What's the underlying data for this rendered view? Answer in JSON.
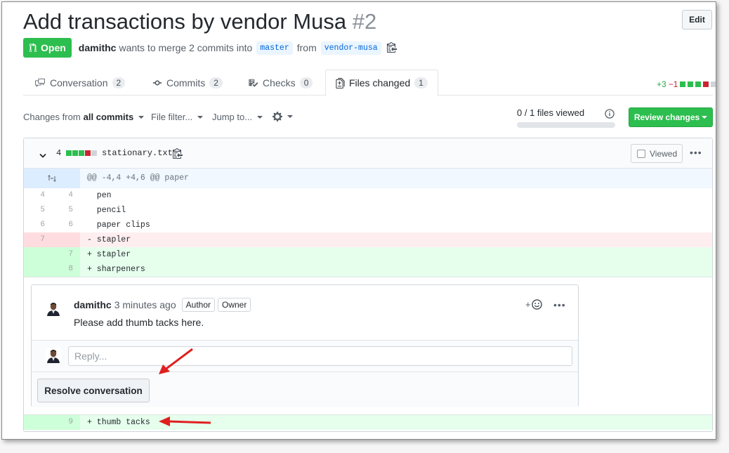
{
  "pr": {
    "title": "Add transactions by vendor Musa",
    "number": "#2",
    "edit_label": "Edit",
    "state": "Open",
    "author": "damithc",
    "merge_text": "wants to merge 2 commits into",
    "base_branch": "master",
    "from_text": "from",
    "head_branch": "vendor-musa"
  },
  "tabs": [
    {
      "label": "Conversation",
      "count": "2",
      "icon": "comment-icon"
    },
    {
      "label": "Commits",
      "count": "2",
      "icon": "commit-icon"
    },
    {
      "label": "Checks",
      "count": "0",
      "icon": "checklist-icon"
    },
    {
      "label": "Files changed",
      "count": "1",
      "icon": "file-diff-icon"
    }
  ],
  "diffstat": {
    "additions": "+3",
    "deletions": "−1"
  },
  "toolbar": {
    "changes_from": "Changes from",
    "all_commits": "all commits",
    "file_filter": "File filter...",
    "jump_to": "Jump to...",
    "files_viewed": "0 / 1 files viewed",
    "files_viewed_fraction": 0,
    "review_changes": "Review changes"
  },
  "file": {
    "change_count": "4",
    "name": "stationary.txt",
    "viewed_label": "Viewed",
    "hunk_header": "@@ -4,4 +4,6 @@ paper",
    "lines": [
      {
        "old": "4",
        "new": "4",
        "text": "  pen"
      },
      {
        "old": "5",
        "new": "5",
        "text": "  pencil"
      },
      {
        "old": "6",
        "new": "6",
        "text": "  paper clips"
      },
      {
        "old": "7",
        "new": "",
        "text": "- stapler"
      },
      {
        "old": "",
        "new": "7",
        "text": "+ stapler"
      },
      {
        "old": "",
        "new": "8",
        "text": "+ sharpeners"
      }
    ],
    "last_line": {
      "old": "",
      "new": "9",
      "text": "+ thumb tacks"
    }
  },
  "comment": {
    "author": "damithc",
    "time": "3 minutes ago",
    "labels": [
      "Author",
      "Owner"
    ],
    "body": "Please add thumb tacks here.",
    "reaction": "+",
    "reply_placeholder": "Reply...",
    "resolve_label": "Resolve conversation"
  },
  "colors": {
    "open_green": "#2cbe4e",
    "addition": "#28a745",
    "deletion": "#cb2431",
    "annotation_arrow": "#e02020"
  }
}
